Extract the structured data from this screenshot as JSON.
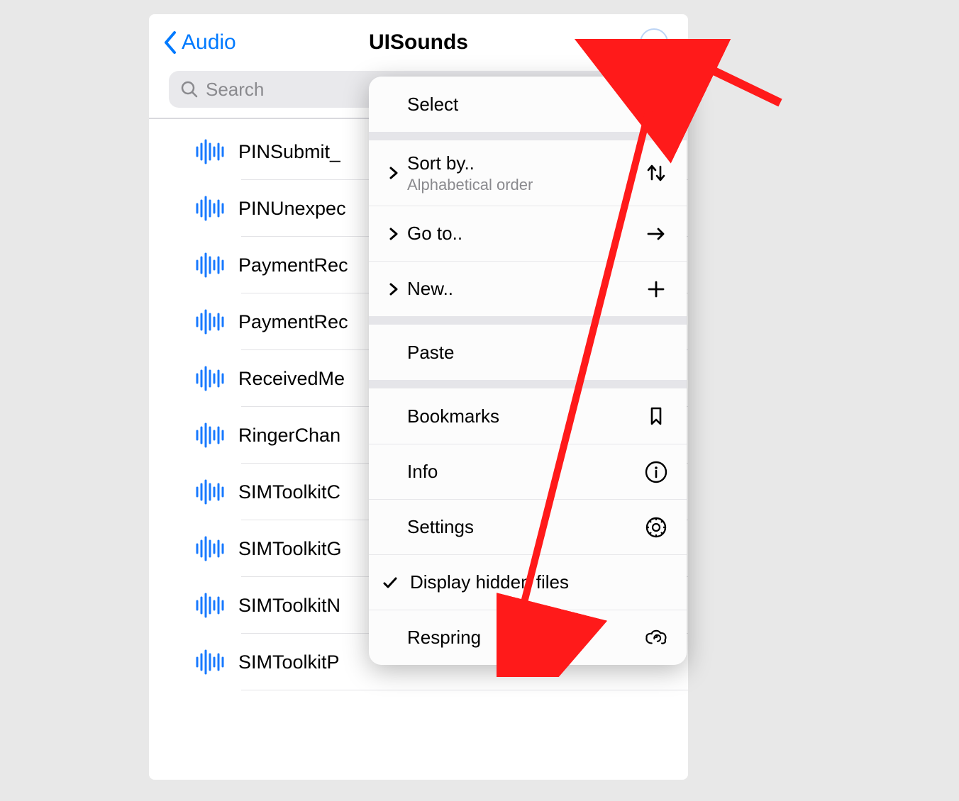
{
  "header": {
    "back_label": "Audio",
    "title": "UISounds"
  },
  "search": {
    "placeholder": "Search"
  },
  "files": [
    {
      "name": "PINSubmit_"
    },
    {
      "name": "PINUnexpec"
    },
    {
      "name": "PaymentRec"
    },
    {
      "name": "PaymentRec"
    },
    {
      "name": "ReceivedMe"
    },
    {
      "name": "RingerChan"
    },
    {
      "name": "SIMToolkitC"
    },
    {
      "name": "SIMToolkitG"
    },
    {
      "name": "SIMToolkitN"
    },
    {
      "name": "SIMToolkitP"
    }
  ],
  "menu": {
    "select_label": "Select",
    "sortby_label": "Sort by..",
    "sortby_sub": "Alphabetical order",
    "goto_label": "Go to..",
    "new_label": "New..",
    "paste_label": "Paste",
    "bookmarks_label": "Bookmarks",
    "info_label": "Info",
    "settings_label": "Settings",
    "display_hidden_label": "Display hidden files",
    "respring_label": "Respring"
  }
}
